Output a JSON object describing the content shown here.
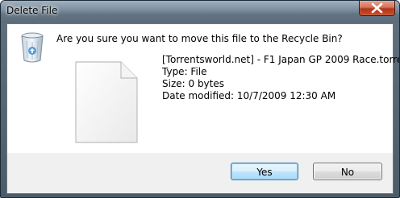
{
  "window": {
    "title": "Delete File"
  },
  "dialog": {
    "question": "Are you sure you want to move this file to the Recycle Bin?",
    "file": {
      "name": "[Torrentsworld.net] - F1 Japan GP 2009 Race.torrent",
      "type": "Type: File",
      "size": "Size: 0 bytes",
      "date_modified": "Date modified: 10/7/2009 12:30 AM"
    }
  },
  "buttons": {
    "yes_label": "Yes",
    "no_label": "No"
  },
  "icons": {
    "title_close": "close-icon",
    "recycle": "recycle-bin-icon",
    "file": "blank-file-icon"
  },
  "colors": {
    "default_button_border": "#3c7fb1",
    "close_button": "#c8502f"
  }
}
